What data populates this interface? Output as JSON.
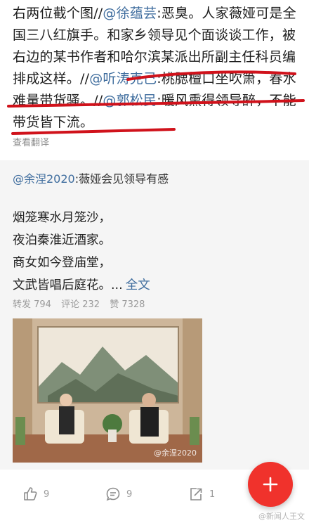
{
  "post": {
    "p1": "右两位截个图//",
    "m1": "@徐蕴芸",
    "p2": ":恶臭。人家薇娅可是全国三八红旗手。和家乡领导见个面谈谈工作，被右边的某书作者和哈尔滨某派出所副主任科员编排成这样。//",
    "m2": "@听涛克己",
    "p3": ":桃腮檀口坐吹箫，春水难量带货骚。//",
    "m3": "@郭松民",
    "p4": ":暖风熏得领导醉，不能带货皆下流。"
  },
  "translate_label": "查看翻译",
  "repost": {
    "author": "@余涅2020",
    "title": ":薇娅会见领导有感",
    "poem": [
      "烟笼寒水月笼沙，",
      "夜泊秦淮近酒家。",
      "商女如今登庙堂，",
      "文武皆唱后庭花。..."
    ],
    "full_text_link": "全文",
    "stats": {
      "reposts": "转发 794",
      "comments": "评论 232",
      "likes": "赞 7328"
    },
    "photo_watermark": "@余涅2020"
  },
  "actions": {
    "like_count": "9",
    "comment_count": "9",
    "repost_count": "1"
  },
  "fab_label": "+",
  "watermark": "@新闻人王文",
  "colors": {
    "mention": "#3f6d9e",
    "fab": "#f0322c",
    "underline": "#d0121b"
  }
}
